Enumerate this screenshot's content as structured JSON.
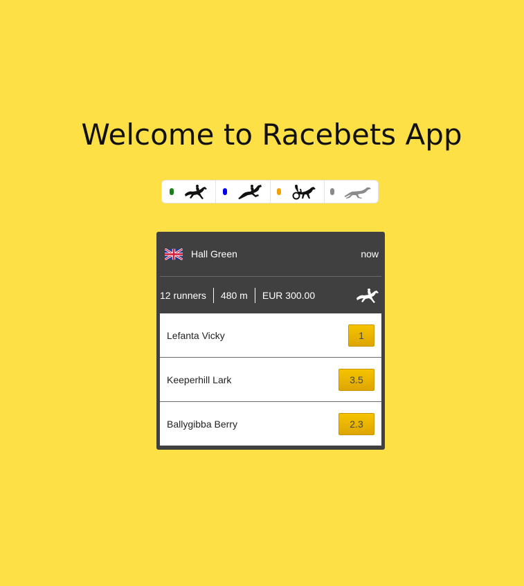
{
  "page": {
    "title": "Welcome to Racebets App",
    "background": "#fde046"
  },
  "filters": [
    {
      "name": "gallop",
      "dot_color": "#1a7f1a",
      "icon": "horse-gallop-icon"
    },
    {
      "name": "jump",
      "dot_color": "#0000ee",
      "icon": "horse-jump-icon"
    },
    {
      "name": "trot",
      "dot_color": "#f0a300",
      "icon": "harness-trot-icon"
    },
    {
      "name": "greyhound",
      "dot_color": "#8a8a8a",
      "icon": "greyhound-icon"
    }
  ],
  "race": {
    "country_flag": "uk-flag-icon",
    "track": "Hall Green",
    "time": "now",
    "runners_count": "12 runners",
    "distance": "480 m",
    "prize": "EUR 300.00",
    "race_type_icon": "horse-gallop-icon"
  },
  "runners": [
    {
      "name": "Lefanta Vicky",
      "odds": "1"
    },
    {
      "name": "Keeperhill Lark",
      "odds": "3.5"
    },
    {
      "name": "Ballygibba Berry",
      "odds": "2.3"
    }
  ]
}
